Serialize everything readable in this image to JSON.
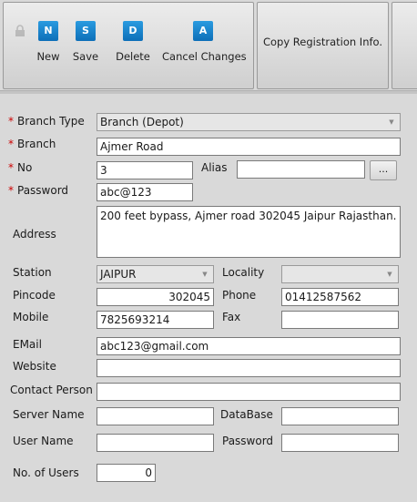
{
  "toolbar": {
    "new_label": "New",
    "save_label": "Save",
    "delete_label": "Delete",
    "cancel_label": "Cancel Changes",
    "copy_label": "Copy Registration Info.",
    "icons": {
      "new": "N",
      "save": "S",
      "delete": "D",
      "cancel": "A"
    }
  },
  "form": {
    "branch_type": {
      "label": "Branch Type",
      "value": "Branch (Depot)"
    },
    "branch": {
      "label": "Branch",
      "value": "Ajmer Road"
    },
    "no": {
      "label": "No",
      "value": "3"
    },
    "alias": {
      "label": "Alias",
      "value": "",
      "button": "..."
    },
    "password": {
      "label": "Password",
      "value": "abc@123"
    },
    "address": {
      "label": "Address",
      "value": "200 feet bypass, Ajmer road 302045 Jaipur Rajasthan."
    },
    "station": {
      "label": "Station",
      "value": "JAIPUR"
    },
    "locality": {
      "label": "Locality",
      "value": ""
    },
    "pincode": {
      "label": "Pincode",
      "value": "302045"
    },
    "phone": {
      "label": "Phone",
      "value": "01412587562"
    },
    "mobile": {
      "label": "Mobile",
      "value": "7825693214"
    },
    "fax": {
      "label": "Fax",
      "value": ""
    },
    "email": {
      "label": "EMail",
      "value": "abc123@gmail.com"
    },
    "website": {
      "label": "Website",
      "value": ""
    },
    "contact_person": {
      "label": "Contact Person",
      "value": ""
    },
    "server_name": {
      "label": "Server Name",
      "value": ""
    },
    "database": {
      "label": "DataBase",
      "value": ""
    },
    "user_name": {
      "label": "User Name",
      "value": ""
    },
    "db_password": {
      "label": "Password",
      "value": ""
    },
    "no_of_users": {
      "label": "No. of Users",
      "value": "0"
    },
    "required_marker": "*"
  },
  "colors": {
    "accent": "#1a86d0",
    "required": "#cc0000",
    "panel": "#d9d9d9"
  }
}
